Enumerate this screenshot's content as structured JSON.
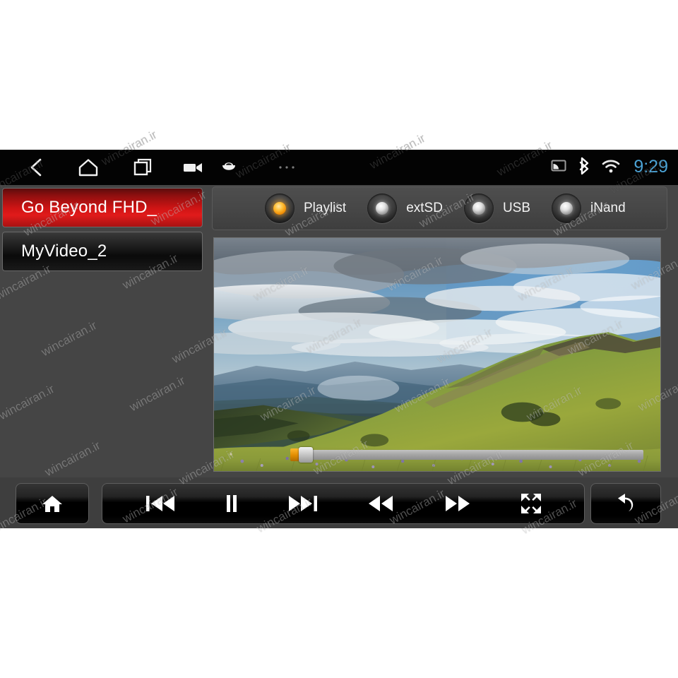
{
  "statusbar": {
    "nav_icons": [
      {
        "name": "back-icon",
        "label": "Back"
      },
      {
        "name": "home-icon",
        "label": "Home"
      },
      {
        "name": "recents-icon",
        "label": "Recent apps"
      },
      {
        "name": "camcorder-icon",
        "label": "Screen record"
      },
      {
        "name": "bag-icon",
        "label": "Apps"
      },
      {
        "name": "overflow-icon",
        "label": "..."
      }
    ],
    "overflow_dots": "•••",
    "status_icons": [
      {
        "name": "cast-icon",
        "label": "Cast"
      },
      {
        "name": "bluetooth-icon",
        "label": "Bluetooth"
      },
      {
        "name": "wifi-icon",
        "label": "Wi-Fi"
      }
    ],
    "clock": "9:29",
    "clock_color": "#4ba3d6"
  },
  "playlist": {
    "items": [
      {
        "title": "Go Beyond FHD_",
        "selected": true
      },
      {
        "title": "MyVideo_2",
        "selected": false
      }
    ]
  },
  "source_bar": {
    "options": [
      {
        "label": "Playlist",
        "active": true
      },
      {
        "label": "extSD",
        "active": false
      },
      {
        "label": "USB",
        "active": false
      },
      {
        "label": "iNand",
        "active": false
      }
    ],
    "active_color": "#f39208",
    "inactive_color": "#e2e2e2"
  },
  "video": {
    "scene": "mountain ridge landscape with cloudy sky and alpine meadow",
    "seek": {
      "progress_percent": 3,
      "fill_color": "#e08b00",
      "track_color": "#a9a9a9"
    }
  },
  "controls": {
    "home": {
      "label": "Home",
      "icon": "home-icon"
    },
    "transport": [
      {
        "label": "Previous",
        "icon": "previous-track-icon"
      },
      {
        "label": "Pause",
        "icon": "pause-icon"
      },
      {
        "label": "Next",
        "icon": "next-track-icon"
      },
      {
        "label": "Rewind",
        "icon": "rewind-icon"
      },
      {
        "label": "Fast forward",
        "icon": "fast-forward-icon"
      },
      {
        "label": "Full screen",
        "icon": "fullscreen-icon"
      }
    ],
    "back": {
      "label": "Return",
      "icon": "return-arrow-icon"
    }
  },
  "watermark": {
    "text": "wincairan.ir"
  },
  "theme": {
    "page_background": "#ffffff",
    "app_background": "#454545",
    "statusbar_background": "#030303",
    "selected_item_red": "#d01414",
    "panel_border": "#5e5e5e"
  }
}
